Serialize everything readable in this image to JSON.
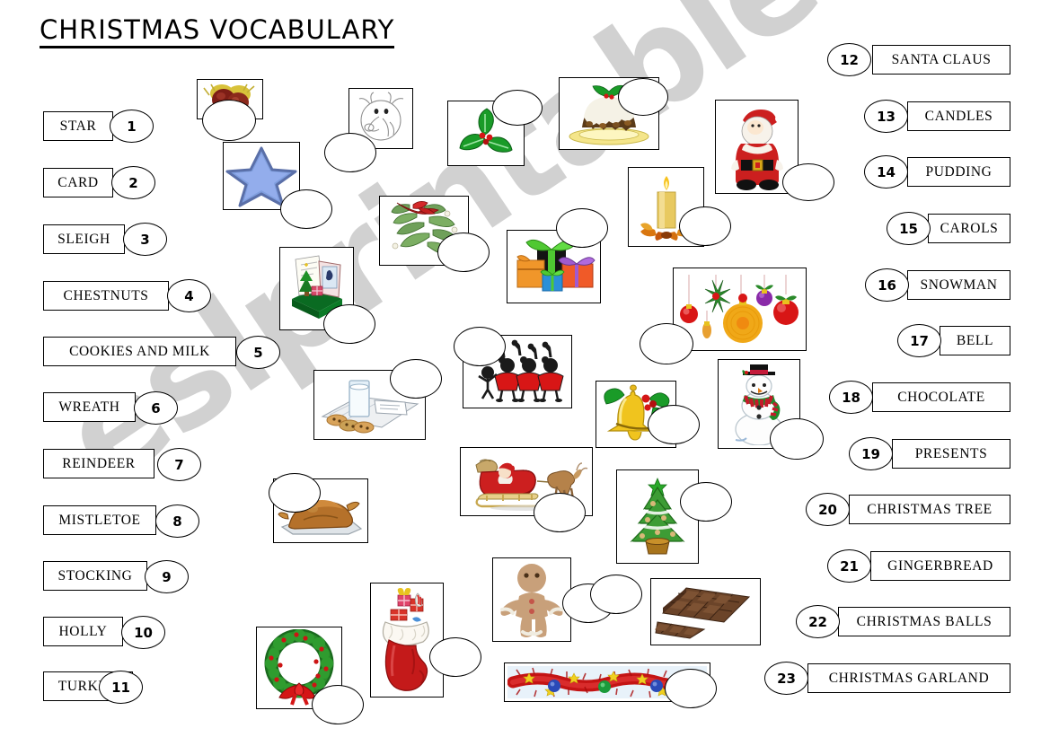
{
  "title": "CHRISTMAS VOCABULARY",
  "watermark": "eslprintables.com",
  "colors": {
    "ink": "#000000",
    "paper": "#ffffff",
    "watermark": "#c9c9c9",
    "holly_green": "#1a9b28",
    "santa_red": "#cc1f1f",
    "star_blue": "#7f9ede",
    "tree_green": "#3d9c35",
    "gold": "#e8b81d",
    "chocolate": "#6b4429"
  },
  "left_column": {
    "items": [
      {
        "number": "1",
        "label": "STAR"
      },
      {
        "number": "2",
        "label": "CARD"
      },
      {
        "number": "3",
        "label": "SLEIGH"
      },
      {
        "number": "4",
        "label": "CHESTNUTS"
      },
      {
        "number": "5",
        "label": "COOKIES AND MILK"
      },
      {
        "number": "6",
        "label": "WREATH"
      },
      {
        "number": "7",
        "label": "REINDEER"
      },
      {
        "number": "8",
        "label": "MISTLETOE"
      },
      {
        "number": "9",
        "label": "STOCKING"
      },
      {
        "number": "10",
        "label": "HOLLY"
      },
      {
        "number": "11",
        "label": "TURKEY"
      }
    ]
  },
  "right_column": {
    "items": [
      {
        "number": "12",
        "label": "SANTA CLAUS"
      },
      {
        "number": "13",
        "label": "CANDLES"
      },
      {
        "number": "14",
        "label": "PUDDING"
      },
      {
        "number": "15",
        "label": "CAROLS"
      },
      {
        "number": "16",
        "label": "SNOWMAN"
      },
      {
        "number": "17",
        "label": "BELL"
      },
      {
        "number": "18",
        "label": "CHOCOLATE"
      },
      {
        "number": "19",
        "label": "PRESENTS"
      },
      {
        "number": "20",
        "label": "CHRISTMAS TREE"
      },
      {
        "number": "21",
        "label": "GINGERBREAD"
      },
      {
        "number": "22",
        "label": "CHRISTMAS BALLS"
      },
      {
        "number": "23",
        "label": "CHRISTMAS GARLAND"
      }
    ]
  },
  "pictures": [
    {
      "id": "chestnuts",
      "icon": "chestnuts-icon",
      "answer": ""
    },
    {
      "id": "reindeer",
      "icon": "reindeer-face-icon",
      "answer": ""
    },
    {
      "id": "holly",
      "icon": "holly-icon",
      "answer": ""
    },
    {
      "id": "pudding",
      "icon": "christmas-pudding-icon",
      "answer": ""
    },
    {
      "id": "santa",
      "icon": "santa-claus-icon",
      "answer": ""
    },
    {
      "id": "star",
      "icon": "star-icon",
      "answer": ""
    },
    {
      "id": "mistletoe",
      "icon": "mistletoe-icon",
      "answer": ""
    },
    {
      "id": "presents",
      "icon": "presents-icon",
      "answer": ""
    },
    {
      "id": "candle",
      "icon": "candle-icon",
      "answer": ""
    },
    {
      "id": "card",
      "icon": "christmas-card-icon",
      "answer": ""
    },
    {
      "id": "christmas-balls",
      "icon": "christmas-balls-icon",
      "answer": ""
    },
    {
      "id": "carols",
      "icon": "carol-singers-icon",
      "answer": ""
    },
    {
      "id": "cookies-milk",
      "icon": "cookies-and-milk-icon",
      "answer": ""
    },
    {
      "id": "bell",
      "icon": "bell-icon",
      "answer": ""
    },
    {
      "id": "snowman",
      "icon": "snowman-icon",
      "answer": ""
    },
    {
      "id": "turkey",
      "icon": "turkey-icon",
      "answer": ""
    },
    {
      "id": "sleigh",
      "icon": "sleigh-icon",
      "answer": ""
    },
    {
      "id": "christmas-tree",
      "icon": "christmas-tree-icon",
      "answer": ""
    },
    {
      "id": "wreath",
      "icon": "wreath-icon",
      "answer": ""
    },
    {
      "id": "stocking",
      "icon": "stocking-icon",
      "answer": ""
    },
    {
      "id": "gingerbread",
      "icon": "gingerbread-man-icon",
      "answer": ""
    },
    {
      "id": "chocolate",
      "icon": "chocolate-bar-icon",
      "answer": ""
    },
    {
      "id": "garland",
      "icon": "christmas-garland-icon",
      "answer": ""
    }
  ]
}
